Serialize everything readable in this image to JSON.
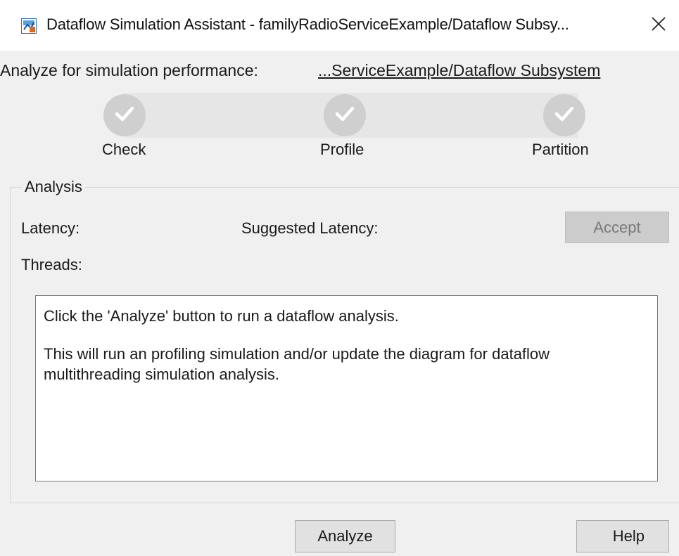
{
  "window": {
    "title": "Dataflow Simulation Assistant - familyRadioServiceExample/Dataflow Subsy...",
    "app_icon": "simulink-model-icon",
    "close_icon": "close-icon"
  },
  "analyze_for": {
    "label": "Analyze for simulation performance:",
    "link": "...ServiceExample/Dataflow Subsystem"
  },
  "stepper": {
    "steps": [
      {
        "label": "Check",
        "status": "complete",
        "icon": "checkmark-icon"
      },
      {
        "label": "Profile",
        "status": "complete",
        "icon": "checkmark-icon"
      },
      {
        "label": "Partition",
        "status": "complete",
        "icon": "checkmark-icon"
      }
    ]
  },
  "analysis": {
    "group_label": "Analysis",
    "latency_label": "Latency:",
    "suggested_latency_label": "Suggested Latency:",
    "threads_label": "Threads:",
    "accept_label": "Accept",
    "accept_enabled": false,
    "message_line1": "Click the 'Analyze' button to run a dataflow analysis.",
    "message_line2": "This will run an profiling simulation and/or update the diagram for dataflow multithreading simulation analysis."
  },
  "buttons": {
    "analyze_label": "Analyze",
    "help_label": "Help"
  },
  "colors": {
    "background": "#f0f0f0",
    "step_circle": "#cfcfcf",
    "step_track": "#e6e6e6",
    "disabled_button": "#cccccc"
  }
}
